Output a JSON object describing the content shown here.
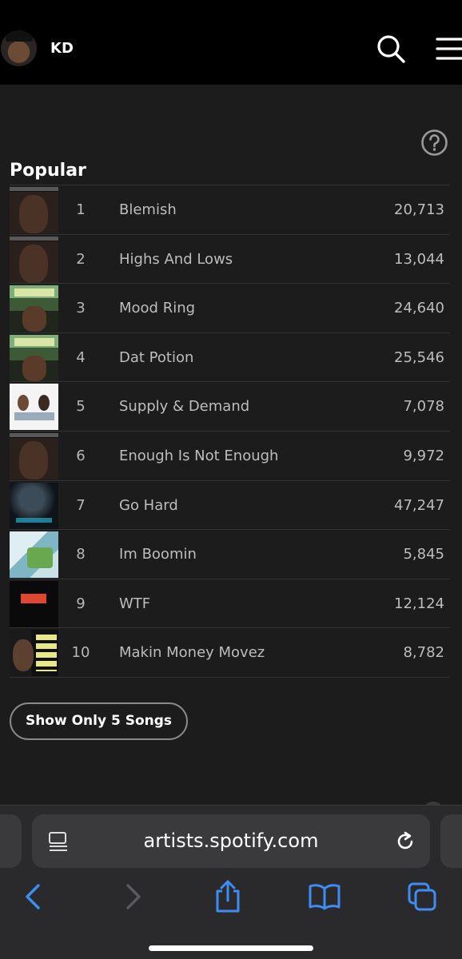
{
  "header": {
    "artist_name": "KD"
  },
  "section": {
    "title": "Popular"
  },
  "tracks": [
    {
      "rank": "1",
      "title": "Blemish",
      "plays": "20,713",
      "art": "face"
    },
    {
      "rank": "2",
      "title": "Highs And Lows",
      "plays": "13,044",
      "art": "face"
    },
    {
      "rank": "3",
      "title": "Mood Ring",
      "plays": "24,640",
      "art": "green"
    },
    {
      "rank": "4",
      "title": "Dat Potion",
      "plays": "25,546",
      "art": "green"
    },
    {
      "rank": "5",
      "title": "Supply & Demand",
      "plays": "7,078",
      "art": "white"
    },
    {
      "rank": "6",
      "title": "Enough Is Not Enough",
      "plays": "9,972",
      "art": "face"
    },
    {
      "rank": "7",
      "title": "Go Hard",
      "plays": "47,247",
      "art": "dark"
    },
    {
      "rank": "8",
      "title": "Im Boomin",
      "plays": "5,845",
      "art": "boom"
    },
    {
      "rank": "9",
      "title": "WTF",
      "plays": "12,124",
      "art": "wtf"
    },
    {
      "rank": "10",
      "title": "Makin Money Movez",
      "plays": "8,782",
      "art": "money"
    }
  ],
  "actions": {
    "show_fewer_label": "Show Only 5 Songs"
  },
  "browser": {
    "url": "artists.spotify.com",
    "icons": [
      "back-icon",
      "forward-icon",
      "share-icon",
      "bookmarks-icon",
      "tabs-icon",
      "reader-icon",
      "reload-icon"
    ],
    "accent_color": "#3d8df5",
    "disabled_color": "#5a5a5e"
  }
}
